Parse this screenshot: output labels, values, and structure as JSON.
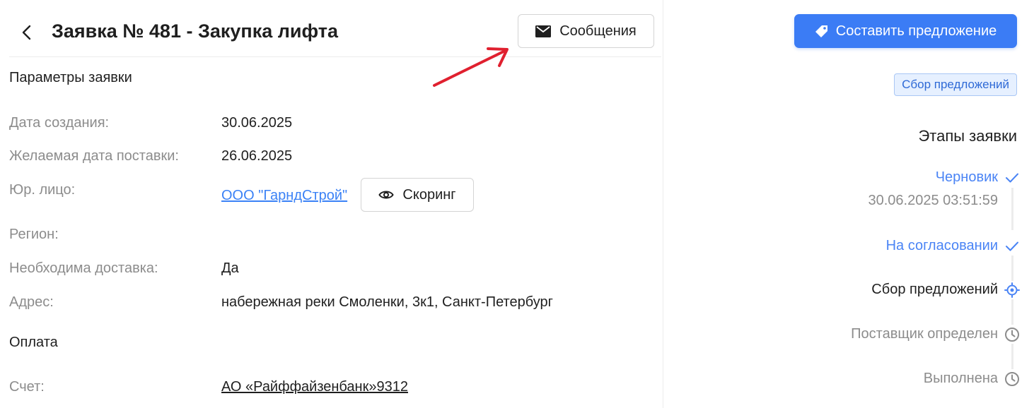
{
  "header": {
    "title": "Заявка № 481 - Закупка лифта",
    "messages_label": "Сообщения"
  },
  "params": {
    "section_title": "Параметры заявки",
    "rows": [
      {
        "label": "Дата создания:",
        "value": "30.06.2025"
      },
      {
        "label": "Желаемая дата поставки:",
        "value": "26.06.2025"
      },
      {
        "label": "Юр. лицо:",
        "value": "ООО \"ГарндСтрой\""
      },
      {
        "label": "Регион:",
        "value": ""
      },
      {
        "label": "Необходима доставка:",
        "value": "Да"
      },
      {
        "label": "Адрес:",
        "value": "набережная реки Смоленки, 3к1, Санкт-Петербург"
      }
    ],
    "scoring_label": "Скоринг"
  },
  "payment": {
    "section_title": "Оплата",
    "account_label": "Счет:",
    "account_value": "АО «Райффайзенбанк»9312"
  },
  "actions": {
    "make_offer_label": "Составить предложение"
  },
  "status": {
    "badge": "Сбор предложений"
  },
  "stages": {
    "title": "Этапы заявки",
    "items": [
      {
        "label": "Черновик",
        "state": "done",
        "icon": "check-icon",
        "time": "30.06.2025 03:51:59"
      },
      {
        "label": "На согласовании",
        "state": "done",
        "icon": "check-icon"
      },
      {
        "label": "Сбор предложений",
        "state": "current",
        "icon": "target-icon"
      },
      {
        "label": "Поставщик определен",
        "state": "pending",
        "icon": "clock-icon"
      },
      {
        "label": "Выполнена",
        "state": "pending",
        "icon": "clock-icon"
      }
    ]
  },
  "colors": {
    "primary": "#3b7cf5",
    "link": "#3b82f6",
    "annotation_arrow": "#e0202f",
    "muted": "#8c8c8c"
  }
}
